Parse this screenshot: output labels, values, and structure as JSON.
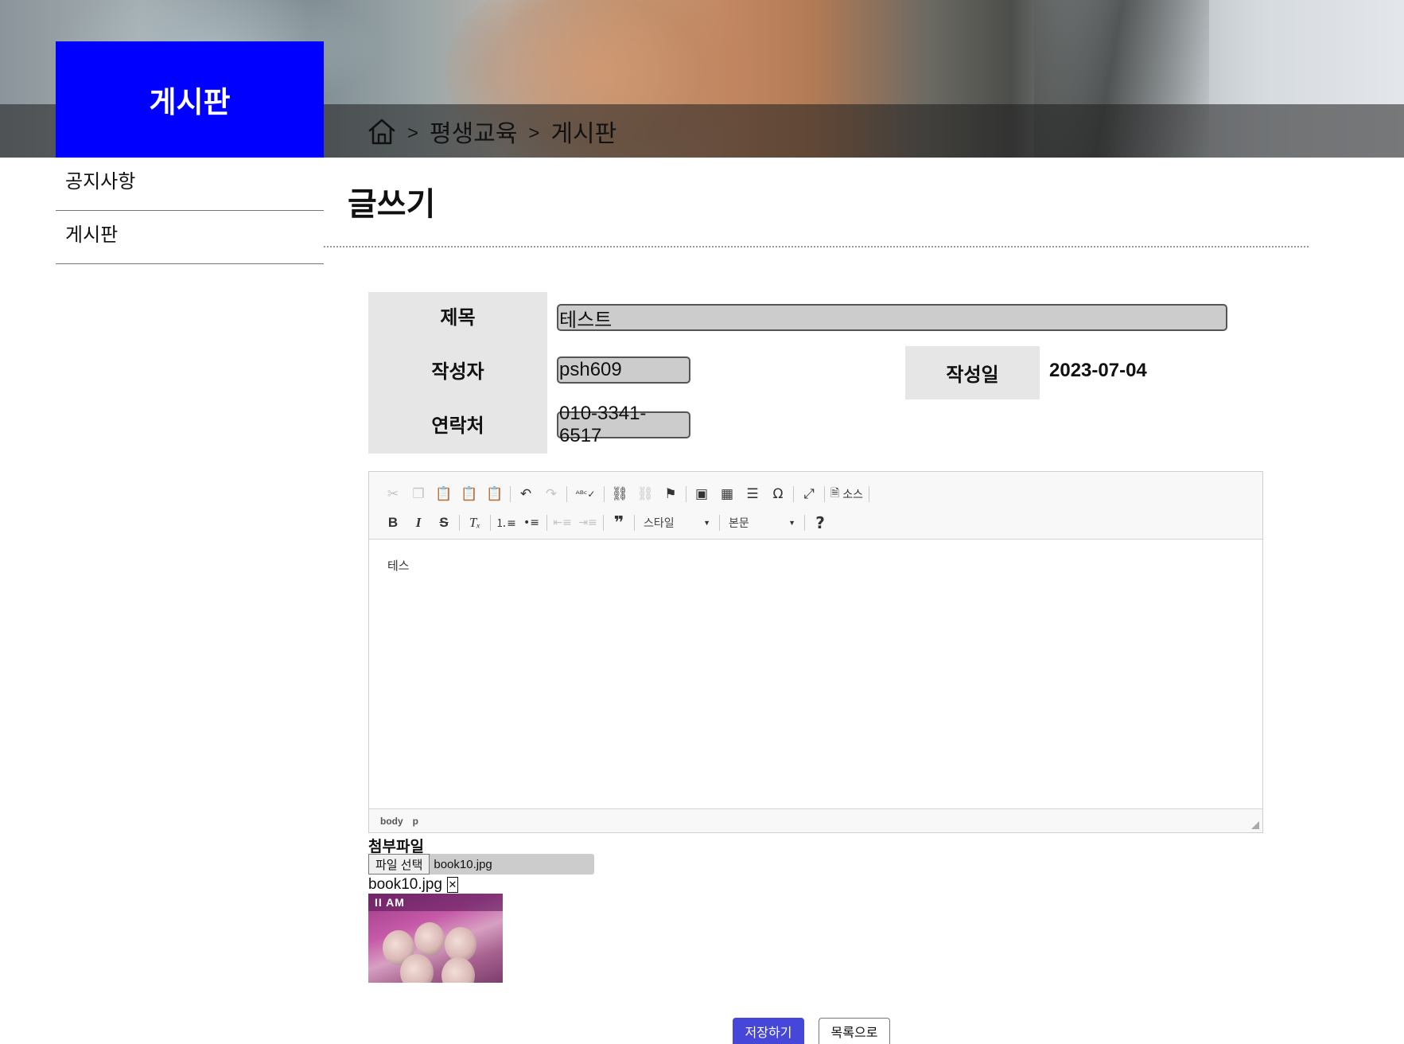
{
  "banner": {
    "board_title": "게시판",
    "breadcrumb": {
      "home_icon": "home-icon",
      "separator": ">",
      "items": [
        "평생교육",
        "게시판"
      ]
    }
  },
  "sidebar": {
    "items": [
      {
        "label": "공지사항"
      },
      {
        "label": "게시판"
      }
    ]
  },
  "main": {
    "page_title": "글쓰기",
    "form": {
      "title_label": "제목",
      "title_value": "테스트",
      "author_label": "작성자",
      "author_value": "psh609",
      "date_label": "작성일",
      "date_value": "2023-07-04",
      "contact_label": "연락처",
      "contact_value": "010-3341-6517"
    },
    "editor": {
      "toolbar_row1": [
        "cut-icon",
        "copy-icon",
        "paste-icon",
        "paste-text-icon",
        "paste-word-icon",
        "undo-icon",
        "redo-icon",
        "spellcheck-icon",
        "link-icon",
        "unlink-icon",
        "anchor-icon",
        "image-icon",
        "table-icon",
        "horizontal-line-icon",
        "special-char-icon",
        "maximize-icon",
        "source-icon"
      ],
      "source_label": "소스",
      "toolbar_row2": [
        "bold-icon",
        "italic-icon",
        "strike-icon",
        "remove-format-icon",
        "numbered-list-icon",
        "bullet-list-icon",
        "outdent-icon",
        "indent-icon",
        "blockquote-icon"
      ],
      "style_combo": "스타일",
      "format_combo": "본문",
      "help": "?",
      "content": "테스",
      "path": [
        "body",
        "p"
      ]
    },
    "attachments": {
      "label": "첨부파일",
      "choose_button": "파일 선택",
      "chosen_file": "book10.jpg",
      "attached_name": "book10.jpg",
      "delete_symbol": "✕",
      "thumb_caption": "II AM"
    },
    "buttons": {
      "save": "저장하기",
      "list": "목록으로"
    }
  },
  "colors": {
    "board_title_bg": "#0000ff",
    "save_button_bg": "#4646d8",
    "label_bg": "#e6e6e6",
    "input_bg": "#cccccc"
  }
}
